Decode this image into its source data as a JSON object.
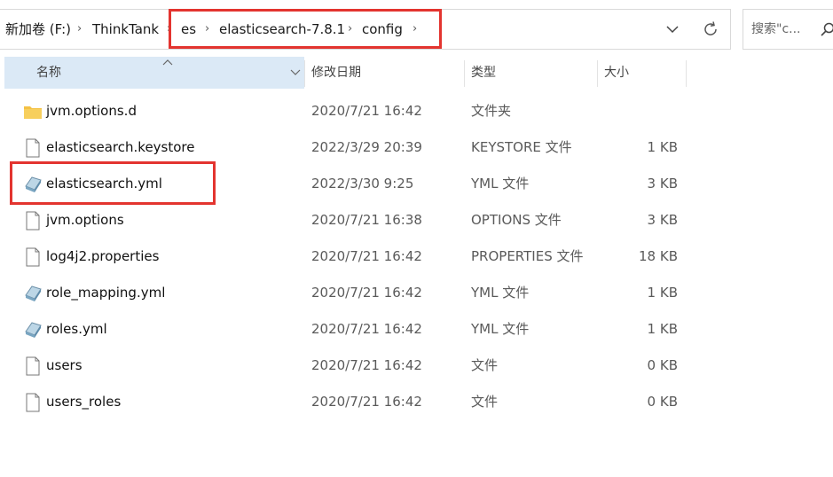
{
  "address": {
    "breadcrumbs": [
      {
        "label": "新加卷 (F:)"
      },
      {
        "label": "ThinkTank"
      },
      {
        "label": "es"
      },
      {
        "label": "elasticsearch-7.8.1"
      },
      {
        "label": "config"
      }
    ],
    "separator": "›",
    "dropdown_icon": "chevron-down-icon",
    "refresh_icon": "refresh-icon"
  },
  "search": {
    "placeholder": "搜索\"c...",
    "icon": "search-icon"
  },
  "columns": {
    "name": "名称",
    "date": "修改日期",
    "type": "类型",
    "size": "大小"
  },
  "files": [
    {
      "name": "jvm.options.d",
      "date": "2020/7/21 16:42",
      "type": "文件夹",
      "size": "",
      "icon": "folder-icon"
    },
    {
      "name": "elasticsearch.keystore",
      "date": "2022/3/29 20:39",
      "type": "KEYSTORE 文件",
      "size": "1 KB",
      "icon": "file-icon"
    },
    {
      "name": "elasticsearch.yml",
      "date": "2022/3/30 9:25",
      "type": "YML 文件",
      "size": "3 KB",
      "icon": "yml-file-icon"
    },
    {
      "name": "jvm.options",
      "date": "2020/7/21 16:38",
      "type": "OPTIONS 文件",
      "size": "3 KB",
      "icon": "file-icon"
    },
    {
      "name": "log4j2.properties",
      "date": "2020/7/21 16:42",
      "type": "PROPERTIES 文件",
      "size": "18 KB",
      "icon": "file-icon"
    },
    {
      "name": "role_mapping.yml",
      "date": "2020/7/21 16:42",
      "type": "YML 文件",
      "size": "1 KB",
      "icon": "yml-file-icon"
    },
    {
      "name": "roles.yml",
      "date": "2020/7/21 16:42",
      "type": "YML 文件",
      "size": "1 KB",
      "icon": "yml-file-icon"
    },
    {
      "name": "users",
      "date": "2020/7/21 16:42",
      "type": "文件",
      "size": "0 KB",
      "icon": "file-icon"
    },
    {
      "name": "users_roles",
      "date": "2020/7/21 16:42",
      "type": "文件",
      "size": "0 KB",
      "icon": "file-icon"
    }
  ],
  "colors": {
    "highlight_box": "#e3342f",
    "name_header_bg": "#dbe9f6",
    "folder": "#f4c144"
  }
}
